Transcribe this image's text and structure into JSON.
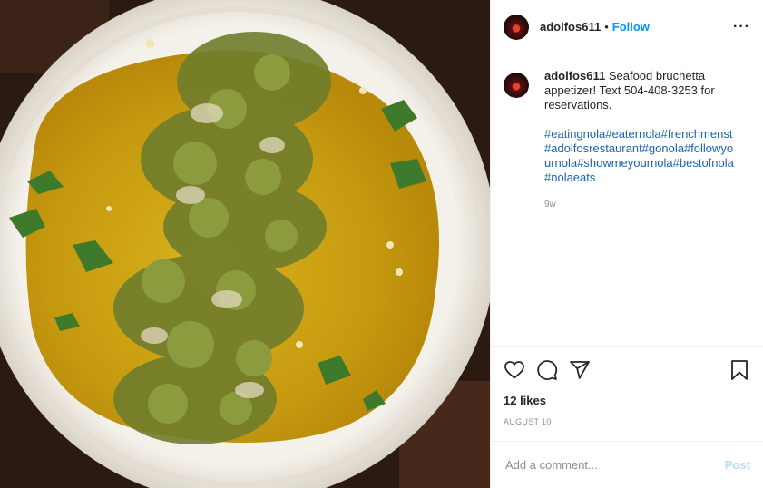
{
  "post": {
    "username": "adolfos611",
    "separator": "•",
    "follow_label": "Follow",
    "more_label": "···"
  },
  "caption": {
    "username": "adolfos611",
    "text": "Seafood bruchetta appetizer! Text 504-408-3253 for reservations.",
    "hashtags": "#eatingnola#eaternola#frenchmenst#adolfosrestaurant#gonola#followyournola#showmeyournola#bestofnola#nolaeats",
    "time_ago": "9w"
  },
  "engagement": {
    "likes": "12 likes",
    "date": "AUGUST 10"
  },
  "comment_box": {
    "placeholder": "Add a comment...",
    "post_label": "Post"
  },
  "icons": [
    "heart-icon",
    "comment-icon",
    "share-icon",
    "bookmark-icon",
    "more-icon"
  ],
  "colors": {
    "follow": "#0095f6",
    "hashtag": "#1a64b4",
    "muted": "#8e8e8e",
    "post_disabled": "#b2dffc"
  }
}
